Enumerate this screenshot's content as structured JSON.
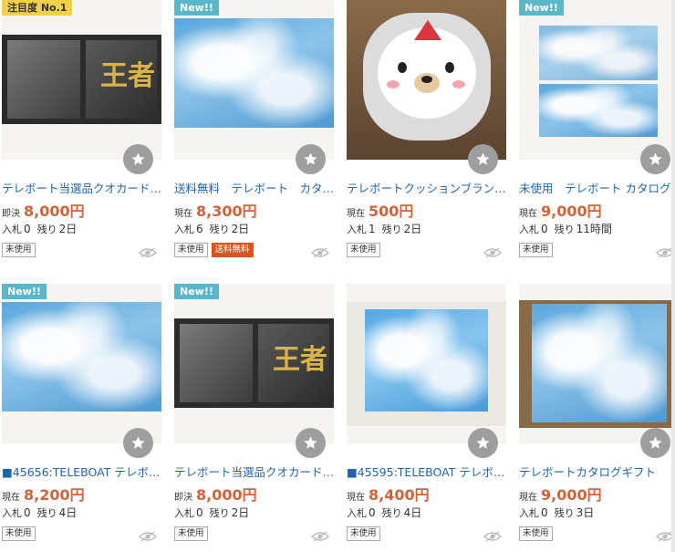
{
  "items": [
    {
      "badge": "注目度 No.1",
      "badge_type": "top",
      "title": "テレボート当選品クオカード…",
      "price_label": "即決",
      "price": "8,000円",
      "bids_label": "入札",
      "bids": "0",
      "remain_label": "残り",
      "remain": "2日",
      "tags": [
        "未使用"
      ],
      "image": "photo-and-card",
      "favorite": "star-icon",
      "watch": "eye-icon"
    },
    {
      "badge": "New!!",
      "badge_type": "new",
      "title": "送料無料　テレボート　カタ…",
      "price_label": "現在",
      "price": "8,300円",
      "bids_label": "入札",
      "bids": "6",
      "remain_label": "残り",
      "remain": "2日",
      "tags": [
        "未使用",
        "送料無料"
      ],
      "image": "sky-catalog",
      "favorite": "star-icon",
      "watch": "eye-icon"
    },
    {
      "badge": "",
      "badge_type": "",
      "title": "テレボートクッションブラン…",
      "price_label": "現在",
      "price": "500円",
      "bids_label": "入札",
      "bids": "1",
      "remain_label": "残り",
      "remain": "2日",
      "tags": [
        "未使用"
      ],
      "image": "bear-cushion",
      "favorite": "star-icon",
      "watch": "eye-icon"
    },
    {
      "badge": "New!!",
      "badge_type": "new",
      "title": "未使用　テレボート カタログ…",
      "price_label": "現在",
      "price": "9,000円",
      "bids_label": "入札",
      "bids": "0",
      "remain_label": "残り",
      "remain": "11時間",
      "tags": [
        "未使用"
      ],
      "image": "sky-catalog",
      "favorite": "star-icon",
      "watch": "eye-icon"
    },
    {
      "badge": "New!!",
      "badge_type": "new",
      "title": "■45656:TELEBOAT テレボ…",
      "price_label": "現在",
      "price": "8,200円",
      "bids_label": "入札",
      "bids": "0",
      "remain_label": "残り",
      "remain": "4日",
      "tags": [
        "未使用"
      ],
      "image": "sky-catalog",
      "favorite": "star-icon",
      "watch": "eye-icon"
    },
    {
      "badge": "New!!",
      "badge_type": "new",
      "title": "テレボート当選品クオカード…",
      "price_label": "即決",
      "price": "8,000円",
      "bids_label": "入札",
      "bids": "0",
      "remain_label": "残り",
      "remain": "2日",
      "tags": [
        "未使用"
      ],
      "image": "photo-and-card",
      "favorite": "star-icon",
      "watch": "eye-icon"
    },
    {
      "badge": "",
      "badge_type": "",
      "title": "■45595:TELEBOAT テレボ…",
      "price_label": "現在",
      "price": "8,400円",
      "bids_label": "入札",
      "bids": "0",
      "remain_label": "残り",
      "remain": "4日",
      "tags": [
        "未使用"
      ],
      "image": "sky-catalog",
      "favorite": "star-icon",
      "watch": "eye-icon"
    },
    {
      "badge": "",
      "badge_type": "",
      "title": "テレボートカタログギフト",
      "price_label": "現在",
      "price": "9,000円",
      "bids_label": "入札",
      "bids": "0",
      "remain_label": "残り",
      "remain": "3日",
      "tags": [
        "未使用"
      ],
      "image": "sky-catalog",
      "favorite": "star-icon",
      "watch": "eye-icon"
    }
  ],
  "kanji_text": "王者",
  "colors": {
    "title": "#1f65ad",
    "price": "#d0633a",
    "new_badge": "#5cb6c9",
    "top_badge": "#f2d04a",
    "ship_tag": "#d9541e"
  }
}
